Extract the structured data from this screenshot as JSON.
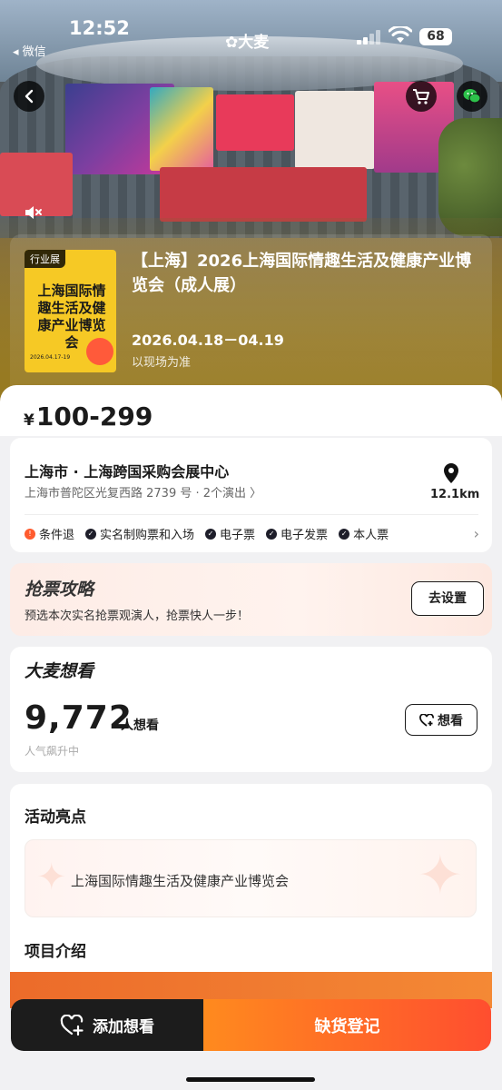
{
  "status_bar": {
    "time": "12:52",
    "back_app": "◂ 微信",
    "brand": "✿大麦",
    "battery": "68"
  },
  "hero": {
    "category_badge": "行业展",
    "cover_text": "上海国际情趣生活及健康产业博览会",
    "cover_date": "2026.04.17-19",
    "title": "【上海】2026上海国际情趣生活及健康产业博览会（成人展）",
    "date": "2026.04.18－04.19",
    "date_note": "以现场为准"
  },
  "price": {
    "currency": "¥",
    "range": "100-299"
  },
  "venue": {
    "name": "上海市 · 上海跨国采购会展中心",
    "address": "上海市普陀区光复西路 2739 号 · 2个演出 〉",
    "distance": "12.1km",
    "tags": [
      {
        "icon": "warning-icon",
        "label": "条件退"
      },
      {
        "icon": "check-icon",
        "label": "实名制购票和入场"
      },
      {
        "icon": "check-icon",
        "label": "电子票"
      },
      {
        "icon": "check-icon",
        "label": "电子发票"
      },
      {
        "icon": "check-icon",
        "label": "本人票"
      }
    ]
  },
  "grab": {
    "title": "抢票攻略",
    "desc": "预选本次实名抢票观演人，抢票快人一步！",
    "button": "去设置"
  },
  "want": {
    "title": "大麦想看",
    "count": "9,772",
    "unit": "人想看",
    "sub": "人气飙升中",
    "button": "想看"
  },
  "highlights": {
    "title": "活动亮点",
    "text": "上海国际情趣生活及健康产业博览会",
    "intro_title": "项目介绍"
  },
  "bottom_bar": {
    "add_want": "添加想看",
    "register": "缺货登记"
  },
  "colors": {
    "accent_orange": "#ff5b2e",
    "dark": "#1c1c1c"
  }
}
